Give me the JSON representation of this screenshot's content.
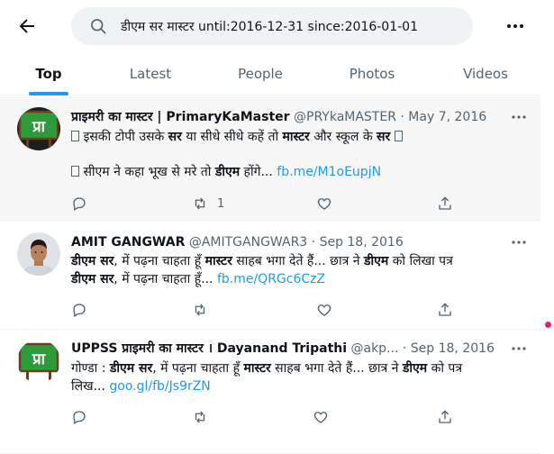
{
  "search": {
    "query": "डीएम सर मास्टर until:2016-12-31 since:2016-01-01"
  },
  "tabs": [
    {
      "label": "Top"
    },
    {
      "label": "Latest"
    },
    {
      "label": "People"
    },
    {
      "label": "Photos"
    },
    {
      "label": "Videos"
    }
  ],
  "tweets": [
    {
      "name": "प्राइमरी का मास्टर | PrimaryKaMaster",
      "handle": "@PRYkaMASTER",
      "sep": "·",
      "date": "May 7, 2016",
      "avatar_text": "प्रा",
      "line1": {
        "a": " इसकी टोपी उसके ",
        "b": "सर",
        "c": " या सीधे सीधे कहें तो ",
        "d": "मास्टर",
        "e": " और स्कूल के ",
        "f": "सर",
        "g": " "
      },
      "line2": {
        "a": " सीएम ने कहा  भूख से मरे तो ",
        "b": "डीएम",
        "c": " होंगे... ",
        "link": "fb.me/M1oEupjN"
      },
      "retweets": "1"
    },
    {
      "name": "AMIT GANGWAR",
      "handle": "@AMITGANGWAR3",
      "sep": "·",
      "date": "Sep 18, 2016",
      "line1": {
        "a": "डीएम सर",
        "b": ", में पढ़ना चाहता हूँ ",
        "c": "मास्टर",
        "d": " साहब भगा देते हैं... छात्र ने ",
        "e": "डीएम",
        "f": " को लिखा पत्र"
      },
      "line2": {
        "a": "डीएम सर",
        "b": ", में पढ़ना चाहता हूँ... ",
        "link": "fb.me/QRGc6CzZ"
      }
    },
    {
      "name": "UPPSS प्राइमरी का मास्टर । Dayanand Tripathi",
      "handle": "@akp...",
      "sep": "·",
      "date": "Sep 18, 2016",
      "avatar_text": "प्रा",
      "line1": {
        "a": "गोण्डा : ",
        "b": "डीएम सर",
        "c": ", में पढ़ना चाहता हूँ ",
        "d": "मास्टर",
        "e": " साहब भगा देते हैं... छात्र ने ",
        "f": "डीएम",
        "g": " को पत्र"
      },
      "line2": {
        "a": "लिख... ",
        "link": "goo.gl/fb/Js9rZN"
      }
    }
  ],
  "colors": {
    "accent": "#1d9bf0",
    "logo_green": "#2e9b3a",
    "notification_dot": "#e0245e"
  }
}
